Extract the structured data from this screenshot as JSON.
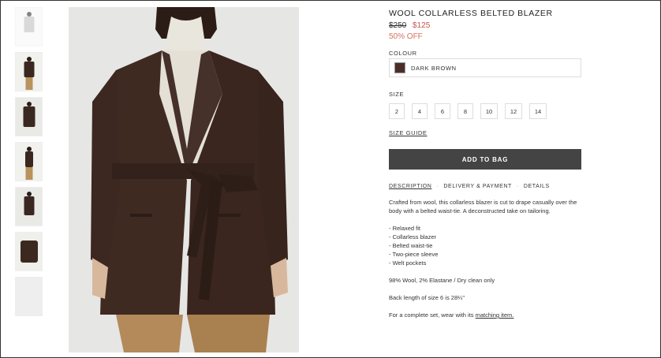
{
  "product": {
    "title": "WOOL COLLARLESS BELTED BLAZER",
    "old_price": "$250",
    "new_price": "$125",
    "discount": "50% OFF"
  },
  "colour": {
    "label": "COLOUR",
    "selected": "DARK BROWN",
    "swatch_color": "#4a2f28"
  },
  "size": {
    "label": "SIZE",
    "options": [
      "2",
      "4",
      "6",
      "8",
      "10",
      "12",
      "14"
    ],
    "guide_label": "SIZE GUIDE"
  },
  "add_to_bag": "ADD TO BAG",
  "tabs": [
    "DESCRIPTION",
    "DELIVERY & PAYMENT",
    "DETAILS"
  ],
  "description": {
    "intro": "Crafted from wool, this collarless blazer is cut to drape casually over the body with a belted waist-tie. A deconstructed take on tailoring.",
    "bullets": [
      "- Relaxed fit",
      "- Collarless blazer",
      "- Belted waist-tie",
      "- Two-piece sleeve",
      "- Welt pockets"
    ],
    "composition": "98% Wool, 2% Elastane / Dry clean only",
    "back_length": "Back length of size 6 is 28¼\"",
    "complete_set_prefix": "For a complete set, wear with its ",
    "complete_set_link": "matching item."
  },
  "colors": {
    "sale": "#c9534d",
    "button": "#444444",
    "blazer": "#3f2a22"
  }
}
